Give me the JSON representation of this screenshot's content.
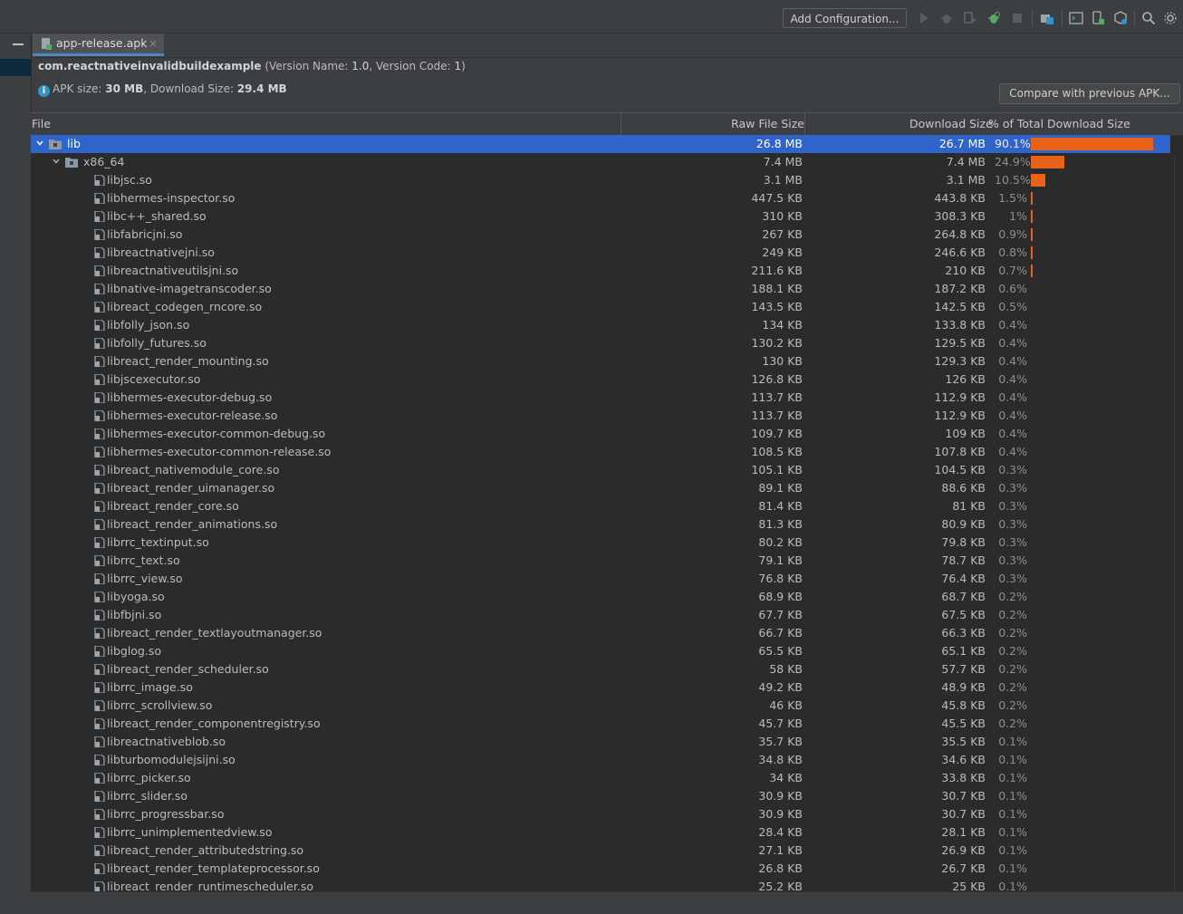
{
  "toolbar": {
    "add_configuration": "Add Configuration...",
    "icons": [
      "run-icon",
      "debug-icon",
      "coverage-icon",
      "profile-icon",
      "stop-icon",
      "project-structure-icon",
      "terminal-icon",
      "device-manager-icon",
      "sdk-manager-icon",
      "search-icon"
    ]
  },
  "tab": {
    "label": "app-release.apk",
    "close": "×"
  },
  "header": {
    "package": "com.reactnativeinvalidbuildexample",
    "version_open": " (Version Name: ",
    "version_name": "1.0",
    "version_mid": ", Version Code: ",
    "version_code": "1",
    "version_close": ")",
    "apk_size_label": "APK size: ",
    "apk_size": "30 MB",
    "download_label": ", Download Size: ",
    "download_size": "29.4 MB",
    "compare_button": "Compare with previous APK..."
  },
  "columns": {
    "file": "File",
    "raw": "Raw File Size",
    "download": "Download Size",
    "percent": "% of Total Download Size"
  },
  "colors": {
    "bar": "#e8621a",
    "selected": "#2f65ca",
    "accent": "#4a88c7"
  },
  "rows": [
    {
      "name": "lib",
      "raw": "26.8 MB",
      "dl": "26.7 MB",
      "pct": "90.1%",
      "pctv": 90.1,
      "level": 0,
      "type": "folder",
      "expanded": true,
      "selected": true
    },
    {
      "name": "x86_64",
      "raw": "7.4 MB",
      "dl": "7.4 MB",
      "pct": "24.9%",
      "pctv": 24.9,
      "level": 1,
      "type": "folder",
      "expanded": true
    },
    {
      "name": "libjsc.so",
      "raw": "3.1 MB",
      "dl": "3.1 MB",
      "pct": "10.5%",
      "pctv": 10.5,
      "level": 2,
      "type": "file"
    },
    {
      "name": "libhermes-inspector.so",
      "raw": "447.5 KB",
      "dl": "443.8 KB",
      "pct": "1.5%",
      "pctv": 1.5,
      "level": 2,
      "type": "file"
    },
    {
      "name": "libc++_shared.so",
      "raw": "310 KB",
      "dl": "308.3 KB",
      "pct": "1%",
      "pctv": 1,
      "level": 2,
      "type": "file"
    },
    {
      "name": "libfabricjni.so",
      "raw": "267 KB",
      "dl": "264.8 KB",
      "pct": "0.9%",
      "pctv": 0.9,
      "level": 2,
      "type": "file"
    },
    {
      "name": "libreactnativejni.so",
      "raw": "249 KB",
      "dl": "246.6 KB",
      "pct": "0.8%",
      "pctv": 0.8,
      "level": 2,
      "type": "file"
    },
    {
      "name": "libreactnativeutilsjni.so",
      "raw": "211.6 KB",
      "dl": "210 KB",
      "pct": "0.7%",
      "pctv": 0.7,
      "level": 2,
      "type": "file"
    },
    {
      "name": "libnative-imagetranscoder.so",
      "raw": "188.1 KB",
      "dl": "187.2 KB",
      "pct": "0.6%",
      "pctv": 0.6,
      "level": 2,
      "type": "file"
    },
    {
      "name": "libreact_codegen_rncore.so",
      "raw": "143.5 KB",
      "dl": "142.5 KB",
      "pct": "0.5%",
      "pctv": 0.5,
      "level": 2,
      "type": "file"
    },
    {
      "name": "libfolly_json.so",
      "raw": "134 KB",
      "dl": "133.8 KB",
      "pct": "0.4%",
      "pctv": 0.4,
      "level": 2,
      "type": "file"
    },
    {
      "name": "libfolly_futures.so",
      "raw": "130.2 KB",
      "dl": "129.5 KB",
      "pct": "0.4%",
      "pctv": 0.4,
      "level": 2,
      "type": "file"
    },
    {
      "name": "libreact_render_mounting.so",
      "raw": "130 KB",
      "dl": "129.3 KB",
      "pct": "0.4%",
      "pctv": 0.4,
      "level": 2,
      "type": "file"
    },
    {
      "name": "libjscexecutor.so",
      "raw": "126.8 KB",
      "dl": "126 KB",
      "pct": "0.4%",
      "pctv": 0.4,
      "level": 2,
      "type": "file"
    },
    {
      "name": "libhermes-executor-debug.so",
      "raw": "113.7 KB",
      "dl": "112.9 KB",
      "pct": "0.4%",
      "pctv": 0.4,
      "level": 2,
      "type": "file"
    },
    {
      "name": "libhermes-executor-release.so",
      "raw": "113.7 KB",
      "dl": "112.9 KB",
      "pct": "0.4%",
      "pctv": 0.4,
      "level": 2,
      "type": "file"
    },
    {
      "name": "libhermes-executor-common-debug.so",
      "raw": "109.7 KB",
      "dl": "109 KB",
      "pct": "0.4%",
      "pctv": 0.4,
      "level": 2,
      "type": "file"
    },
    {
      "name": "libhermes-executor-common-release.so",
      "raw": "108.5 KB",
      "dl": "107.8 KB",
      "pct": "0.4%",
      "pctv": 0.4,
      "level": 2,
      "type": "file"
    },
    {
      "name": "libreact_nativemodule_core.so",
      "raw": "105.1 KB",
      "dl": "104.5 KB",
      "pct": "0.3%",
      "pctv": 0.3,
      "level": 2,
      "type": "file"
    },
    {
      "name": "libreact_render_uimanager.so",
      "raw": "89.1 KB",
      "dl": "88.6 KB",
      "pct": "0.3%",
      "pctv": 0.3,
      "level": 2,
      "type": "file"
    },
    {
      "name": "libreact_render_core.so",
      "raw": "81.4 KB",
      "dl": "81 KB",
      "pct": "0.3%",
      "pctv": 0.3,
      "level": 2,
      "type": "file"
    },
    {
      "name": "libreact_render_animations.so",
      "raw": "81.3 KB",
      "dl": "80.9 KB",
      "pct": "0.3%",
      "pctv": 0.3,
      "level": 2,
      "type": "file"
    },
    {
      "name": "librrc_textinput.so",
      "raw": "80.2 KB",
      "dl": "79.8 KB",
      "pct": "0.3%",
      "pctv": 0.3,
      "level": 2,
      "type": "file"
    },
    {
      "name": "librrc_text.so",
      "raw": "79.1 KB",
      "dl": "78.7 KB",
      "pct": "0.3%",
      "pctv": 0.3,
      "level": 2,
      "type": "file"
    },
    {
      "name": "librrc_view.so",
      "raw": "76.8 KB",
      "dl": "76.4 KB",
      "pct": "0.3%",
      "pctv": 0.3,
      "level": 2,
      "type": "file"
    },
    {
      "name": "libyoga.so",
      "raw": "68.9 KB",
      "dl": "68.7 KB",
      "pct": "0.2%",
      "pctv": 0.2,
      "level": 2,
      "type": "file"
    },
    {
      "name": "libfbjni.so",
      "raw": "67.7 KB",
      "dl": "67.5 KB",
      "pct": "0.2%",
      "pctv": 0.2,
      "level": 2,
      "type": "file"
    },
    {
      "name": "libreact_render_textlayoutmanager.so",
      "raw": "66.7 KB",
      "dl": "66.3 KB",
      "pct": "0.2%",
      "pctv": 0.2,
      "level": 2,
      "type": "file"
    },
    {
      "name": "libglog.so",
      "raw": "65.5 KB",
      "dl": "65.1 KB",
      "pct": "0.2%",
      "pctv": 0.2,
      "level": 2,
      "type": "file"
    },
    {
      "name": "libreact_render_scheduler.so",
      "raw": "58 KB",
      "dl": "57.7 KB",
      "pct": "0.2%",
      "pctv": 0.2,
      "level": 2,
      "type": "file"
    },
    {
      "name": "librrc_image.so",
      "raw": "49.2 KB",
      "dl": "48.9 KB",
      "pct": "0.2%",
      "pctv": 0.2,
      "level": 2,
      "type": "file"
    },
    {
      "name": "librrc_scrollview.so",
      "raw": "46 KB",
      "dl": "45.8 KB",
      "pct": "0.2%",
      "pctv": 0.2,
      "level": 2,
      "type": "file"
    },
    {
      "name": "libreact_render_componentregistry.so",
      "raw": "45.7 KB",
      "dl": "45.5 KB",
      "pct": "0.2%",
      "pctv": 0.2,
      "level": 2,
      "type": "file"
    },
    {
      "name": "libreactnativeblob.so",
      "raw": "35.7 KB",
      "dl": "35.5 KB",
      "pct": "0.1%",
      "pctv": 0.1,
      "level": 2,
      "type": "file"
    },
    {
      "name": "libturbomodulejsijni.so",
      "raw": "34.8 KB",
      "dl": "34.6 KB",
      "pct": "0.1%",
      "pctv": 0.1,
      "level": 2,
      "type": "file"
    },
    {
      "name": "librrc_picker.so",
      "raw": "34 KB",
      "dl": "33.8 KB",
      "pct": "0.1%",
      "pctv": 0.1,
      "level": 2,
      "type": "file"
    },
    {
      "name": "librrc_slider.so",
      "raw": "30.9 KB",
      "dl": "30.7 KB",
      "pct": "0.1%",
      "pctv": 0.1,
      "level": 2,
      "type": "file"
    },
    {
      "name": "librrc_progressbar.so",
      "raw": "30.9 KB",
      "dl": "30.7 KB",
      "pct": "0.1%",
      "pctv": 0.1,
      "level": 2,
      "type": "file"
    },
    {
      "name": "librrc_unimplementedview.so",
      "raw": "28.4 KB",
      "dl": "28.1 KB",
      "pct": "0.1%",
      "pctv": 0.1,
      "level": 2,
      "type": "file"
    },
    {
      "name": "libreact_render_attributedstring.so",
      "raw": "27.1 KB",
      "dl": "26.9 KB",
      "pct": "0.1%",
      "pctv": 0.1,
      "level": 2,
      "type": "file"
    },
    {
      "name": "libreact_render_templateprocessor.so",
      "raw": "26.8 KB",
      "dl": "26.7 KB",
      "pct": "0.1%",
      "pctv": 0.1,
      "level": 2,
      "type": "file"
    },
    {
      "name": "libreact_render_runtimescheduler.so",
      "raw": "25.2 KB",
      "dl": "25 KB",
      "pct": "0.1%",
      "pctv": 0.1,
      "level": 2,
      "type": "file"
    }
  ]
}
